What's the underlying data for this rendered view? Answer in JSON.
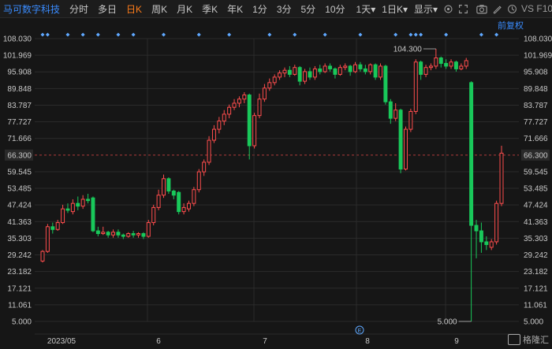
{
  "toolbar": {
    "stock_name": "马可数字科技",
    "tabs": [
      "分时",
      "多日",
      "日K",
      "周K",
      "月K",
      "季K",
      "年K",
      "1分",
      "3分",
      "5分",
      "10分"
    ],
    "active_tab": "日K",
    "period_select": "1天",
    "kline_select": "1日K",
    "display_select": "显示",
    "vs_label": "VS F10"
  },
  "adjust_label": "前复权",
  "watermark": "格隆汇",
  "colors": {
    "up": "#ff4d4d",
    "down": "#19c85a",
    "accent": "#ff7d1a",
    "link": "#3a8cff",
    "grid": "#2b2b2b"
  },
  "chart_data": {
    "type": "candlestick",
    "y_ticks": [
      "108.030",
      "101.969",
      "95.908",
      "89.848",
      "83.787",
      "77.727",
      "71.666",
      "66.300",
      "59.545",
      "53.485",
      "47.424",
      "41.363",
      "35.303",
      "29.242",
      "23.182",
      "17.121",
      "11.061",
      "5.000"
    ],
    "current_price": "66.300",
    "x_labels": [
      "2023/05",
      "6",
      "7",
      "8",
      "9"
    ],
    "annotations": {
      "high": "104.300",
      "low": "5.000"
    },
    "ylim": [
      5.0,
      108.03
    ],
    "candles": [
      {
        "o": 27.0,
        "c": 30.5,
        "h": 31.0,
        "l": 26.5
      },
      {
        "o": 30.5,
        "c": 39.5,
        "h": 40.5,
        "l": 30.0
      },
      {
        "o": 39.5,
        "c": 38.5,
        "h": 41.0,
        "l": 37.0
      },
      {
        "o": 38.5,
        "c": 41.0,
        "h": 42.0,
        "l": 38.0
      },
      {
        "o": 41.0,
        "c": 46.0,
        "h": 47.5,
        "l": 40.5
      },
      {
        "o": 46.0,
        "c": 45.5,
        "h": 48.0,
        "l": 44.5
      },
      {
        "o": 45.0,
        "c": 48.0,
        "h": 49.5,
        "l": 44.0
      },
      {
        "o": 48.0,
        "c": 47.0,
        "h": 50.5,
        "l": 45.5
      },
      {
        "o": 47.0,
        "c": 49.5,
        "h": 51.0,
        "l": 46.0
      },
      {
        "o": 49.5,
        "c": 49.0,
        "h": 51.5,
        "l": 48.0
      },
      {
        "o": 50.0,
        "c": 38.0,
        "h": 50.5,
        "l": 37.5
      },
      {
        "o": 38.0,
        "c": 37.0,
        "h": 39.5,
        "l": 36.0
      },
      {
        "o": 37.0,
        "c": 37.5,
        "h": 39.5,
        "l": 36.5
      },
      {
        "o": 37.5,
        "c": 36.5,
        "h": 38.0,
        "l": 35.5
      },
      {
        "o": 36.5,
        "c": 37.5,
        "h": 38.5,
        "l": 35.5
      },
      {
        "o": 37.5,
        "c": 36.5,
        "h": 38.5,
        "l": 35.5
      },
      {
        "o": 36.5,
        "c": 36.0,
        "h": 37.0,
        "l": 35.0
      },
      {
        "o": 36.0,
        "c": 37.0,
        "h": 37.5,
        "l": 35.5
      },
      {
        "o": 37.0,
        "c": 36.5,
        "h": 38.0,
        "l": 35.5
      },
      {
        "o": 36.5,
        "c": 37.0,
        "h": 37.5,
        "l": 35.5
      },
      {
        "o": 37.0,
        "c": 36.0,
        "h": 37.5,
        "l": 35.0
      },
      {
        "o": 36.0,
        "c": 41.0,
        "h": 42.0,
        "l": 35.5
      },
      {
        "o": 41.0,
        "c": 46.5,
        "h": 47.5,
        "l": 40.0
      },
      {
        "o": 46.5,
        "c": 51.0,
        "h": 53.0,
        "l": 45.5
      },
      {
        "o": 51.0,
        "c": 57.0,
        "h": 58.5,
        "l": 50.0
      },
      {
        "o": 57.0,
        "c": 52.5,
        "h": 57.5,
        "l": 51.5
      },
      {
        "o": 52.5,
        "c": 51.0,
        "h": 53.0,
        "l": 49.5
      },
      {
        "o": 52.0,
        "c": 45.0,
        "h": 52.5,
        "l": 44.0
      },
      {
        "o": 45.0,
        "c": 46.5,
        "h": 48.0,
        "l": 44.0
      },
      {
        "o": 46.0,
        "c": 48.0,
        "h": 49.0,
        "l": 45.0
      },
      {
        "o": 48.0,
        "c": 53.0,
        "h": 54.0,
        "l": 47.0
      },
      {
        "o": 53.0,
        "c": 59.5,
        "h": 60.5,
        "l": 52.0
      },
      {
        "o": 59.5,
        "c": 63.0,
        "h": 64.0,
        "l": 58.0
      },
      {
        "o": 63.0,
        "c": 71.0,
        "h": 72.5,
        "l": 62.0
      },
      {
        "o": 71.0,
        "c": 75.0,
        "h": 76.5,
        "l": 70.0
      },
      {
        "o": 75.0,
        "c": 78.0,
        "h": 79.5,
        "l": 73.5
      },
      {
        "o": 78.0,
        "c": 80.5,
        "h": 82.0,
        "l": 76.5
      },
      {
        "o": 80.5,
        "c": 83.0,
        "h": 84.0,
        "l": 79.0
      },
      {
        "o": 83.0,
        "c": 84.5,
        "h": 86.0,
        "l": 82.0
      },
      {
        "o": 84.5,
        "c": 86.0,
        "h": 87.0,
        "l": 83.0
      },
      {
        "o": 86.0,
        "c": 87.5,
        "h": 88.5,
        "l": 84.5
      },
      {
        "o": 87.5,
        "c": 69.0,
        "h": 88.0,
        "l": 64.0
      },
      {
        "o": 69.0,
        "c": 80.0,
        "h": 81.0,
        "l": 68.0
      },
      {
        "o": 80.0,
        "c": 86.0,
        "h": 88.0,
        "l": 79.0
      },
      {
        "o": 86.0,
        "c": 90.0,
        "h": 91.5,
        "l": 85.0
      },
      {
        "o": 90.0,
        "c": 92.0,
        "h": 93.5,
        "l": 89.0
      },
      {
        "o": 92.0,
        "c": 94.0,
        "h": 95.0,
        "l": 91.0
      },
      {
        "o": 94.0,
        "c": 95.5,
        "h": 96.5,
        "l": 93.0
      },
      {
        "o": 95.5,
        "c": 96.5,
        "h": 97.5,
        "l": 94.0
      },
      {
        "o": 96.5,
        "c": 95.0,
        "h": 98.0,
        "l": 94.0
      },
      {
        "o": 95.0,
        "c": 97.5,
        "h": 98.5,
        "l": 94.5
      },
      {
        "o": 97.5,
        "c": 92.5,
        "h": 98.0,
        "l": 91.0
      },
      {
        "o": 92.5,
        "c": 96.0,
        "h": 97.0,
        "l": 91.5
      },
      {
        "o": 96.0,
        "c": 94.0,
        "h": 97.5,
        "l": 93.0
      },
      {
        "o": 94.0,
        "c": 97.0,
        "h": 98.0,
        "l": 93.0
      },
      {
        "o": 97.0,
        "c": 96.0,
        "h": 98.5,
        "l": 95.0
      },
      {
        "o": 96.0,
        "c": 98.0,
        "h": 99.0,
        "l": 95.5
      },
      {
        "o": 98.0,
        "c": 97.0,
        "h": 99.0,
        "l": 96.0
      },
      {
        "o": 97.0,
        "c": 95.0,
        "h": 97.5,
        "l": 93.5
      },
      {
        "o": 95.0,
        "c": 97.5,
        "h": 98.5,
        "l": 94.5
      },
      {
        "o": 97.5,
        "c": 98.0,
        "h": 99.0,
        "l": 96.5
      },
      {
        "o": 98.0,
        "c": 96.0,
        "h": 98.5,
        "l": 94.5
      },
      {
        "o": 96.0,
        "c": 98.5,
        "h": 99.5,
        "l": 95.5
      },
      {
        "o": 98.5,
        "c": 97.0,
        "h": 99.5,
        "l": 96.0
      },
      {
        "o": 97.0,
        "c": 96.0,
        "h": 98.5,
        "l": 95.0
      },
      {
        "o": 96.0,
        "c": 98.5,
        "h": 99.0,
        "l": 95.0
      },
      {
        "o": 98.5,
        "c": 94.0,
        "h": 99.0,
        "l": 93.0
      },
      {
        "o": 94.0,
        "c": 98.0,
        "h": 99.0,
        "l": 93.0
      },
      {
        "o": 98.0,
        "c": 85.0,
        "h": 98.5,
        "l": 84.0
      },
      {
        "o": 85.0,
        "c": 79.0,
        "h": 86.0,
        "l": 77.0
      },
      {
        "o": 79.0,
        "c": 82.0,
        "h": 84.5,
        "l": 78.0
      },
      {
        "o": 82.0,
        "c": 60.5,
        "h": 82.5,
        "l": 59.0
      },
      {
        "o": 60.5,
        "c": 75.0,
        "h": 76.0,
        "l": 60.0
      },
      {
        "o": 75.0,
        "c": 81.5,
        "h": 82.5,
        "l": 74.0
      },
      {
        "o": 81.5,
        "c": 99.5,
        "h": 100.5,
        "l": 80.5
      },
      {
        "o": 99.5,
        "c": 95.0,
        "h": 100.0,
        "l": 93.0
      },
      {
        "o": 95.0,
        "c": 97.5,
        "h": 98.5,
        "l": 94.0
      },
      {
        "o": 97.5,
        "c": 98.0,
        "h": 99.0,
        "l": 96.5
      },
      {
        "o": 98.0,
        "c": 101.0,
        "h": 104.3,
        "l": 97.0
      },
      {
        "o": 101.0,
        "c": 99.0,
        "h": 101.5,
        "l": 97.5
      },
      {
        "o": 99.0,
        "c": 98.0,
        "h": 100.5,
        "l": 97.0
      },
      {
        "o": 98.0,
        "c": 99.5,
        "h": 100.5,
        "l": 97.0
      },
      {
        "o": 99.5,
        "c": 97.0,
        "h": 100.0,
        "l": 96.0
      },
      {
        "o": 97.0,
        "c": 98.0,
        "h": 99.0,
        "l": 96.5
      },
      {
        "o": 98.0,
        "c": 100.0,
        "h": 101.0,
        "l": 97.0
      },
      {
        "o": 92.0,
        "c": 40.0,
        "h": 92.5,
        "l": 5.0
      },
      {
        "o": 40.0,
        "c": 38.0,
        "h": 42.0,
        "l": 28.0
      },
      {
        "o": 38.0,
        "c": 34.0,
        "h": 41.0,
        "l": 30.0
      },
      {
        "o": 34.0,
        "c": 33.0,
        "h": 36.0,
        "l": 31.0
      },
      {
        "o": 32.0,
        "c": 34.0,
        "h": 35.0,
        "l": 31.0
      },
      {
        "o": 34.0,
        "c": 48.0,
        "h": 49.0,
        "l": 33.0
      },
      {
        "o": 48.0,
        "c": 66.3,
        "h": 69.0,
        "l": 47.0
      }
    ]
  }
}
